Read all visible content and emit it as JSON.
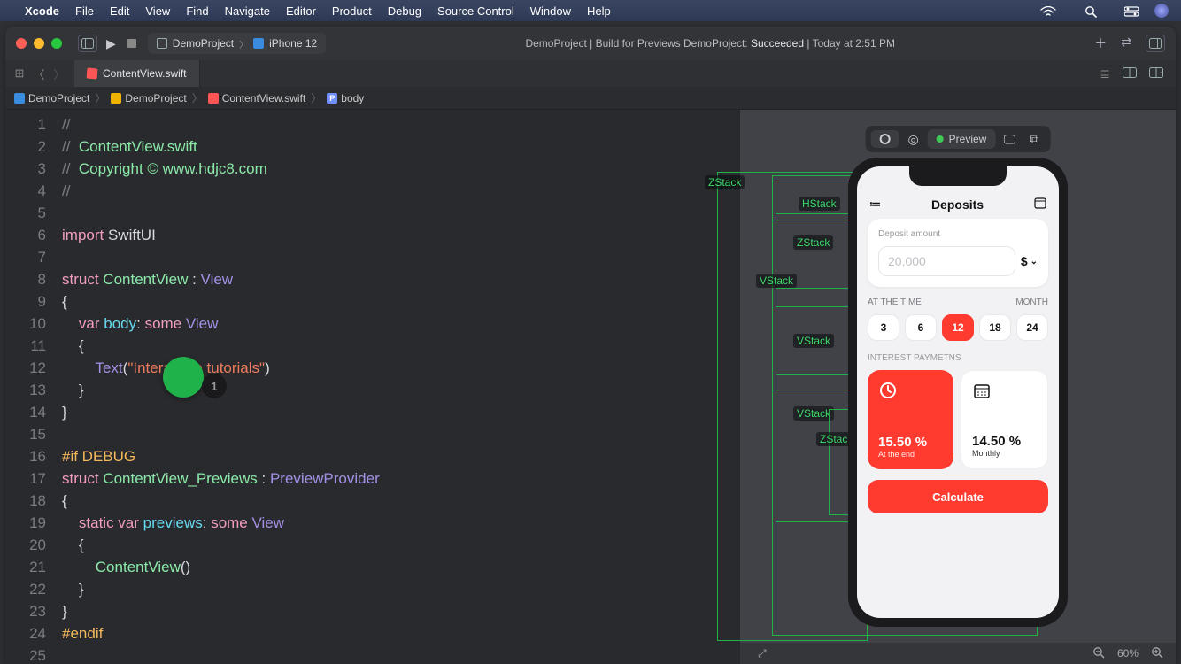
{
  "menubar": {
    "app": "Xcode",
    "items": [
      "File",
      "Edit",
      "View",
      "Find",
      "Navigate",
      "Editor",
      "Product",
      "Debug",
      "Source Control",
      "Window",
      "Help"
    ]
  },
  "titlebar": {
    "scheme_project": "DemoProject",
    "scheme_device": "iPhone 12",
    "activity_prefix": "DemoProject | Build for Previews DemoProject: ",
    "activity_status": "Succeeded",
    "activity_suffix": " | Today at 2:51 PM"
  },
  "tab": {
    "filename": "ContentView.swift"
  },
  "crumbs": {
    "a": "DemoProject",
    "b": "DemoProject",
    "c": "ContentView.swift",
    "d": "body",
    "d_badge": "P"
  },
  "code": {
    "l1": "//",
    "l2a": "//  ",
    "l2b": "ContentView.swift",
    "l3a": "//  ",
    "l3b": "Copyright © www.hdjc8.com",
    "l4": "//",
    "l5": "",
    "l6a": "import",
    "l6b": " SwiftUI",
    "l7": "",
    "l8a": "struct",
    "l8b": " ContentView",
    "l8c": " : ",
    "l8d": "View",
    "l9": "{",
    "l10a": "    var",
    "l10b": " body",
    "l10c": ": ",
    "l10d": "some",
    "l10e": " View",
    "l11": "    {",
    "l12a": "        Text",
    "l12b": "(",
    "l12c": "\"Interactive tutorials\"",
    "l12d": ")",
    "l13": "    }",
    "l14": "}",
    "l15": "",
    "l16": "#if DEBUG",
    "l17a": "struct",
    "l17b": " ContentView_Previews",
    "l17c": " : ",
    "l17d": "PreviewProvider",
    "l18": "{",
    "l19a": "    static",
    "l19b": " var",
    "l19c": " previews",
    "l19d": ": ",
    "l19e": "some",
    "l19f": " View",
    "l20": "    {",
    "l21a": "        ContentView",
    "l21b": "()",
    "l22": "    }",
    "l23": "}",
    "l24": "#endif",
    "l25": "",
    "gutters": [
      "1",
      "2",
      "3",
      "4",
      "5",
      "6",
      "7",
      "8",
      "9",
      "10",
      "11",
      "12",
      "13",
      "14",
      "15",
      "16",
      "17",
      "18",
      "19",
      "20",
      "21",
      "22",
      "23",
      "24",
      "25"
    ]
  },
  "cursor": {
    "badge": "1"
  },
  "preview": {
    "live": "Preview",
    "app": {
      "title": "Deposits",
      "deposit_label": "Deposit amount",
      "deposit_placeholder": "20,000",
      "currency": "$",
      "row_left": "AT THE TIME",
      "row_right": "MONTH",
      "months": [
        "3",
        "6",
        "12",
        "18",
        "24"
      ],
      "month_selected": "12",
      "ip_title": "INTEREST PAYMETNS",
      "red_pct": "15.50 %",
      "red_sub": "At the end",
      "wht_pct": "14.50 %",
      "wht_sub": "Monthly",
      "calc": "Calculate"
    },
    "outlines": {
      "zstack1": "ZStack",
      "vstack1": "VStack",
      "hstack": "HStack",
      "zstack2": "ZStack",
      "vstack2": "VStack",
      "vstack3": "VStack",
      "zstack3": "ZStack"
    },
    "footer_zoom": "60%"
  }
}
